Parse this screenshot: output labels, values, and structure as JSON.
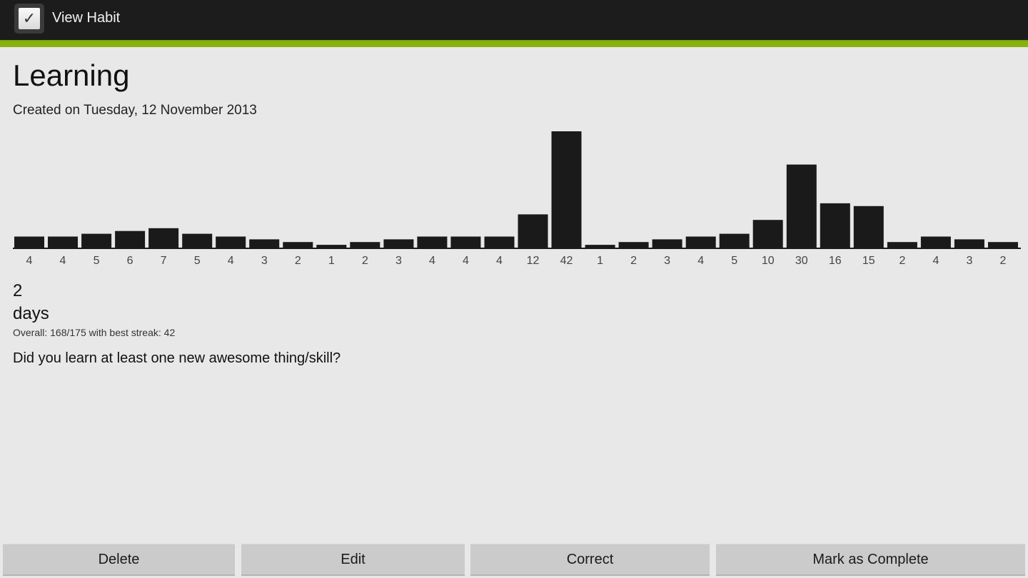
{
  "actionbar": {
    "title": "View Habit",
    "icon": "checkbox-checked-icon",
    "icon_glyph": "✓",
    "accent_color": "#86b10f"
  },
  "habit": {
    "name": "Learning",
    "created": "Created on Tuesday, 12 November 2013",
    "current_streak": "2",
    "streak_unit": "days",
    "overall": "Overall: 168/175 with best streak: 42",
    "question": "Did you learn at least one new awesome thing/skill?"
  },
  "chart_data": {
    "type": "bar",
    "title": "",
    "xlabel": "",
    "ylabel": "",
    "categories": [
      "4",
      "4",
      "5",
      "6",
      "7",
      "5",
      "4",
      "3",
      "2",
      "1",
      "2",
      "3",
      "4",
      "4",
      "4",
      "12",
      "42",
      "1",
      "2",
      "3",
      "4",
      "5",
      "10",
      "30",
      "16",
      "15",
      "2",
      "4",
      "3",
      "2"
    ],
    "values": [
      4,
      4,
      5,
      6,
      7,
      5,
      4,
      3,
      2,
      1,
      2,
      3,
      4,
      4,
      4,
      12,
      42,
      1,
      2,
      3,
      4,
      5,
      10,
      30,
      16,
      15,
      2,
      4,
      3,
      2
    ],
    "ylim": [
      0,
      42
    ],
    "grid": false,
    "legend": "none",
    "bar_color": "#1a1a1a"
  },
  "buttons": {
    "delete": "Delete",
    "edit": "Edit",
    "correct": "Correct",
    "complete": "Mark as Complete"
  }
}
